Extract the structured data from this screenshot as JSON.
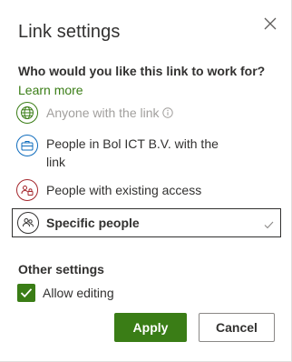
{
  "dialog": {
    "title": "Link settings",
    "close_icon": "close-icon"
  },
  "audience": {
    "question": "Who would you like this link to work for?",
    "learn_more": "Learn more",
    "options": [
      {
        "label": "Anyone with the link",
        "icon": "globe-icon",
        "disabled": true,
        "info_icon": "info-icon"
      },
      {
        "label": "People in Bol ICT B.V. with the link",
        "icon": "briefcase-icon",
        "disabled": false
      },
      {
        "label": "People with existing access",
        "icon": "people-lock-icon",
        "disabled": false
      },
      {
        "label": "Specific people",
        "icon": "people-icon",
        "selected": true,
        "check_icon": "checkmark-icon"
      }
    ]
  },
  "other_settings": {
    "heading": "Other settings",
    "allow_editing": {
      "label": "Allow editing",
      "checked": true
    }
  },
  "actions": {
    "apply_label": "Apply",
    "cancel_label": "Cancel"
  },
  "colors": {
    "accent": "#3a7d16",
    "text": "#323130",
    "disabled_text": "#a19f9d",
    "org_icon": "#0f6cbd",
    "existing_icon": "#a4262c"
  }
}
